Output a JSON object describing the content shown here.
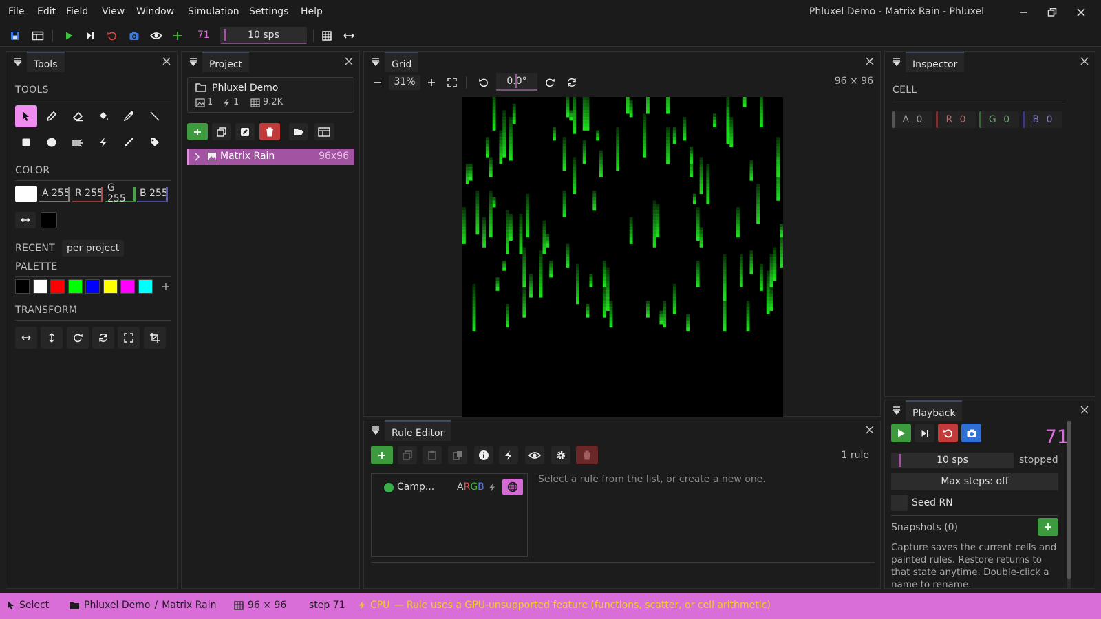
{
  "window": {
    "title": "Phluxel Demo - Matrix Rain - Phluxel",
    "menu": [
      "File",
      "Edit",
      "Field",
      "View",
      "Window",
      "Simulation",
      "Settings",
      "Help"
    ]
  },
  "toolbar": {
    "step": "71",
    "speed": "10 sps"
  },
  "tools_panel": {
    "title": "Tools",
    "tools_label": "TOOLS",
    "color_label": "COLOR",
    "channels": {
      "a": "A 255",
      "r": "R 255",
      "g": "G 255",
      "b": "B 255"
    },
    "recent_label": "RECENT",
    "recent_mode": "per project",
    "palette_label": "PALETTE",
    "palette_colors": [
      "#000000",
      "#ffffff",
      "#ff0000",
      "#00ff00",
      "#0000ff",
      "#ffff00",
      "#ff00ff",
      "#00ffff"
    ],
    "transform_label": "TRANSFORM"
  },
  "project_panel": {
    "title": "Project",
    "project_name": "Phluxel Demo",
    "images_count": "1",
    "rules_count": "1",
    "cells_count": "9.2K",
    "field_name": "Matrix Rain",
    "field_size": "96x96"
  },
  "grid_panel": {
    "title": "Grid",
    "zoom": "31%",
    "rotation": "0.0°",
    "dims": "96 × 96"
  },
  "inspector_panel": {
    "title": "Inspector",
    "cell_label": "CELL",
    "channels": {
      "a": "A 0",
      "r": "R 0",
      "g": "G 0",
      "b": "B 0"
    }
  },
  "rule_editor": {
    "title": "Rule Editor",
    "count": "1 rule",
    "rule_name": "Camp...",
    "rule_tag_a": "A",
    "rule_tag_r": "R",
    "rule_tag_g": "G",
    "rule_tag_b": "B",
    "empty_hint": "Select a rule from the list, or create a new one."
  },
  "playback_panel": {
    "title": "Playback",
    "step": "71",
    "speed": "10 sps",
    "state": "stopped",
    "max_steps": "Max steps: off",
    "seed_label": "Seed RN",
    "snapshots_label": "Snapshots (0)",
    "snapshots_help": "Capture saves the current cells and painted rules. Restore returns to that state anytime. Double-click a name to rename."
  },
  "statusbar": {
    "tool": "Select",
    "project": "Phluxel Demo",
    "separator": "/",
    "field": "Matrix Rain",
    "dims": "96 × 96",
    "step": "step 71",
    "backend": "CPU",
    "message": "— Rule uses a GPU-unsupported feature (functions, scatter, or cell arithmetic)"
  },
  "colors": {
    "accent": "#d96ed9",
    "panel_bg": "#1c1c1c",
    "green_btn": "#3e9a3e",
    "red_btn": "#c23a3a",
    "blue_btn": "#2f6fd6",
    "rain": "#1ee01e"
  }
}
